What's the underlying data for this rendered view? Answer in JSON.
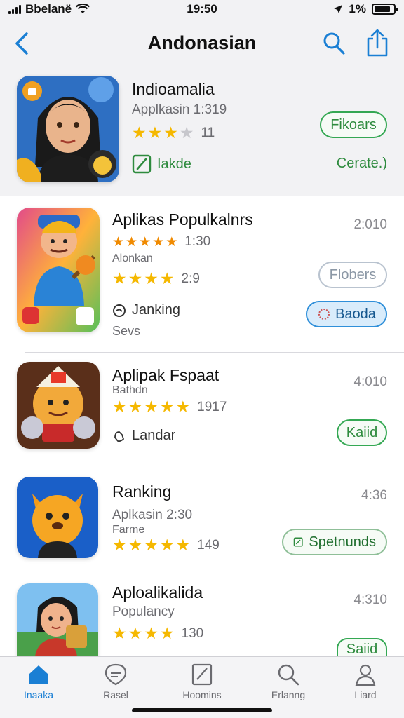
{
  "status": {
    "carrier": "Bbelanë",
    "time": "19:50",
    "battery": "1%"
  },
  "nav": {
    "title": "Andonasian"
  },
  "featured": {
    "name": "Indioamalia",
    "subtitle": "Applkasin 1:319",
    "rating": 3,
    "rating_count": "11",
    "button": "Fikoars",
    "tag": "Iakde",
    "link": "Cerate.)"
  },
  "apps": [
    {
      "name": "Aplikas Populkalnrs",
      "meta": "2:010",
      "line1": "1:30",
      "line2": "Alonkan",
      "rating": 4,
      "rating_count": "2:9",
      "button_gray": "Flobers",
      "tag": "Janking",
      "tag_sub": "Sevs",
      "button": "Baoda"
    },
    {
      "name": "Aplipak Fspaat",
      "meta": "4:010",
      "line1": "Bathdn",
      "rating": 5,
      "rating_count": "1917",
      "tag": "Landar",
      "button": "Kaiid"
    },
    {
      "name": "Ranking",
      "meta": "4:36",
      "line1": "Aplkasin 2:30",
      "line2": "Farme",
      "rating": 5,
      "rating_count": "149",
      "button": "Spetnunds"
    },
    {
      "name": "Aploalikalida",
      "meta": "4:310",
      "line1": "Populancy",
      "rating": 4,
      "rating_count": "130",
      "button": "Saiid"
    }
  ],
  "tabs": [
    {
      "label": "Inaaka",
      "icon": "home-icon",
      "active": true
    },
    {
      "label": "Rasel",
      "icon": "tag-icon",
      "active": false
    },
    {
      "label": "Hoomins",
      "icon": "note-icon",
      "active": false
    },
    {
      "label": "Erlanng",
      "icon": "search-icon",
      "active": false
    },
    {
      "label": "Liard",
      "icon": "person-icon",
      "active": false
    }
  ],
  "colors": {
    "accent": "#1a7fd4",
    "star": "#f5b800",
    "green": "#34a853"
  }
}
